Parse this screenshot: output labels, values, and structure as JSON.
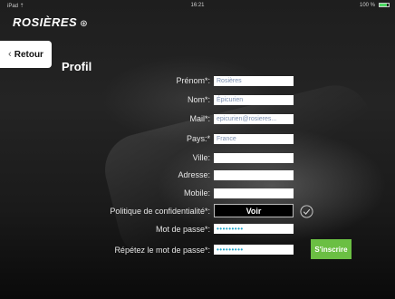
{
  "status": {
    "device": "iPad ⇡",
    "time": "16:21",
    "battery": "100 %"
  },
  "brand": {
    "logo": "ROSIÈRES",
    "mark": "⊛"
  },
  "nav": {
    "back_label": "Retour",
    "back_chevron": "‹"
  },
  "page": {
    "title": "Profil"
  },
  "form": {
    "prenom": {
      "label": "Prénom*:",
      "value": "Rosières"
    },
    "nom": {
      "label": "Nom*:",
      "value": "Épicurien"
    },
    "mail": {
      "label": "Mail*:",
      "value": "epicurien@rosieres..."
    },
    "pays": {
      "label": "Pays:*",
      "value": "France"
    },
    "ville": {
      "label": "Ville:",
      "value": ""
    },
    "adresse": {
      "label": "Adresse:",
      "value": ""
    },
    "mobile": {
      "label": "Mobile:",
      "value": ""
    },
    "politique": {
      "label": "Politique de confidentialité*:",
      "button": "Voir",
      "checked": true
    },
    "mot_de_passe": {
      "label": "Mot de passe*:",
      "value": "•••••••••"
    },
    "repetez": {
      "label": "Répétez le mot de passe*:",
      "value": "•••••••••"
    },
    "submit_label": "S'inscrire"
  },
  "colors": {
    "accent_green": "#6bbf43",
    "password_dots": "#1fa3c8",
    "background": "#1e1e1e"
  }
}
